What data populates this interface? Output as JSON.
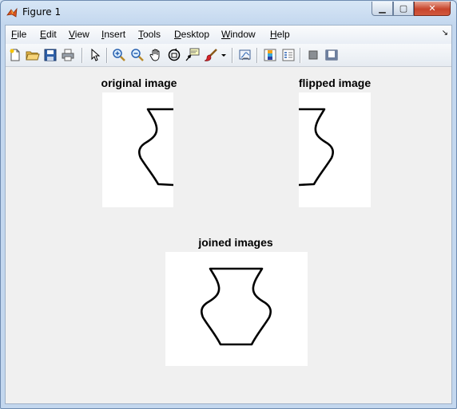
{
  "window": {
    "title": "Figure 1",
    "minimize_icon": "minimize-icon",
    "maximize_icon": "maximize-icon",
    "close_icon": "close-icon"
  },
  "menu": [
    "File",
    "Edit",
    "View",
    "Insert",
    "Tools",
    "Desktop",
    "Window",
    "Help"
  ],
  "toolbar": [
    "new-figure-icon",
    "open-file-icon",
    "save-icon",
    "print-icon",
    "arrow-pointer-icon",
    "zoom-in-icon",
    "zoom-out-icon",
    "pan-hand-icon",
    "rotate-3d-icon",
    "data-cursor-icon",
    "brush-icon",
    "brush-dropdown-icon",
    "link-plot-icon",
    "insert-colorbar-icon",
    "insert-legend-icon",
    "hide-plot-tools-icon",
    "show-plot-tools-icon"
  ],
  "plots": {
    "original": {
      "title": "original image"
    },
    "flipped": {
      "title": "flipped image"
    },
    "joined": {
      "title": "joined images"
    }
  },
  "colors": {
    "figure_bg": "#f0f0f0",
    "image_bg": "#ffffff",
    "outline": "#000000",
    "close_button": "#c7452c"
  }
}
